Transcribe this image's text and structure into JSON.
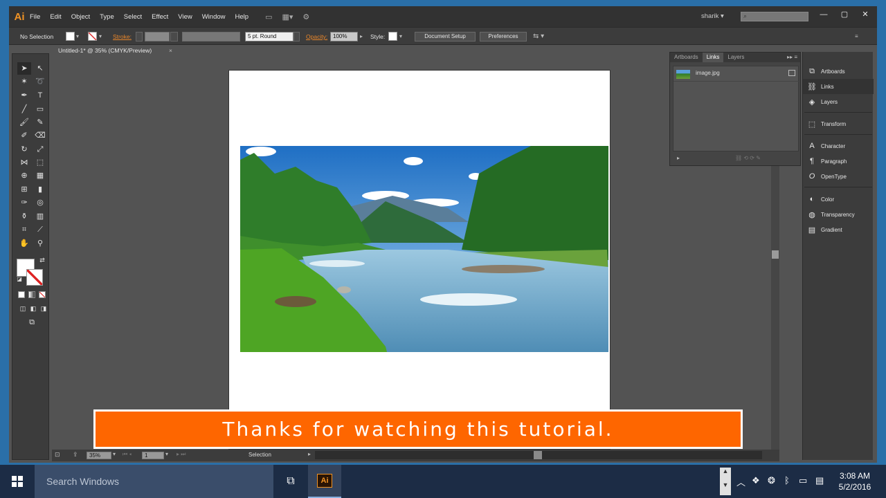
{
  "app": {
    "logo": "Ai",
    "menu": [
      "File",
      "Edit",
      "Object",
      "Type",
      "Select",
      "Effect",
      "View",
      "Window",
      "Help"
    ],
    "user": "sharik",
    "search_placeholder": ""
  },
  "control": {
    "selection": "No Selection",
    "stroke_label": "Stroke:",
    "brush": "5 pt. Round",
    "opacity_label": "Opacity:",
    "opacity": "100%",
    "style_label": "Style:",
    "doc_setup": "Document Setup",
    "preferences": "Preferences"
  },
  "doc": {
    "tab": "Untitled-1* @ 35% (CMYK/Preview)",
    "close": "×"
  },
  "status": {
    "zoom": "35%",
    "artboard": "1",
    "tool": "Selection"
  },
  "links_panel": {
    "tabs": [
      "Artboards",
      "Links",
      "Layers"
    ],
    "active_tab": "Links",
    "item": "image.jpg"
  },
  "dock": {
    "items": [
      "Artboards",
      "Links",
      "Layers",
      "Transform",
      "Character",
      "Paragraph",
      "OpenType",
      "Color",
      "Transparency",
      "Gradient"
    ],
    "active": "Links"
  },
  "banner": {
    "text": "Thanks for watching this tutorial."
  },
  "taskbar": {
    "search": "Search Windows",
    "time": "3:08 AM",
    "date": "5/2/2016"
  },
  "colors": {
    "accent": "#fe6600",
    "ai_orange": "#f29425"
  }
}
